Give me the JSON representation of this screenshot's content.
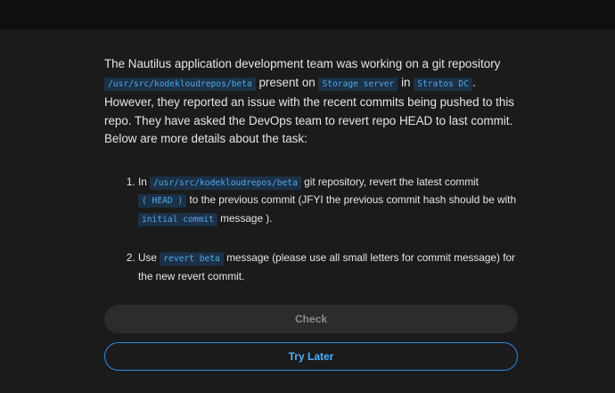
{
  "intro": {
    "t1": "The Nautilus application development team was working on a git repository ",
    "c1": "/usr/src/kodekloudrepos/beta",
    "t2": " present on ",
    "c2": "Storage server",
    "t3": " in ",
    "c3": "Stratos DC",
    "t4": ". However, they reported an issue with the recent commits being pushed to this repo. They have asked the DevOps team to revert repo HEAD to last commit. Below are more details about the task:"
  },
  "tasks": [
    {
      "t1": "In ",
      "c1": "/usr/src/kodekloudrepos/beta",
      "t2": " git repository, revert the latest commit ",
      "c2": "( HEAD )",
      "t3": " to the previous commit (JFYI the previous commit hash should be with ",
      "c3": "initial commit",
      "t4": " message )."
    },
    {
      "t1": "Use ",
      "c1": "revert beta",
      "t2": " message (please use all small letters for commit message) for the new revert commit."
    }
  ],
  "buttons": {
    "check": "Check",
    "try_later": "Try Later"
  },
  "colors": {
    "background": "#1b1b1c",
    "code_text": "#4fa8e8",
    "code_bg": "#1c3147",
    "accent": "#2f8be0"
  }
}
